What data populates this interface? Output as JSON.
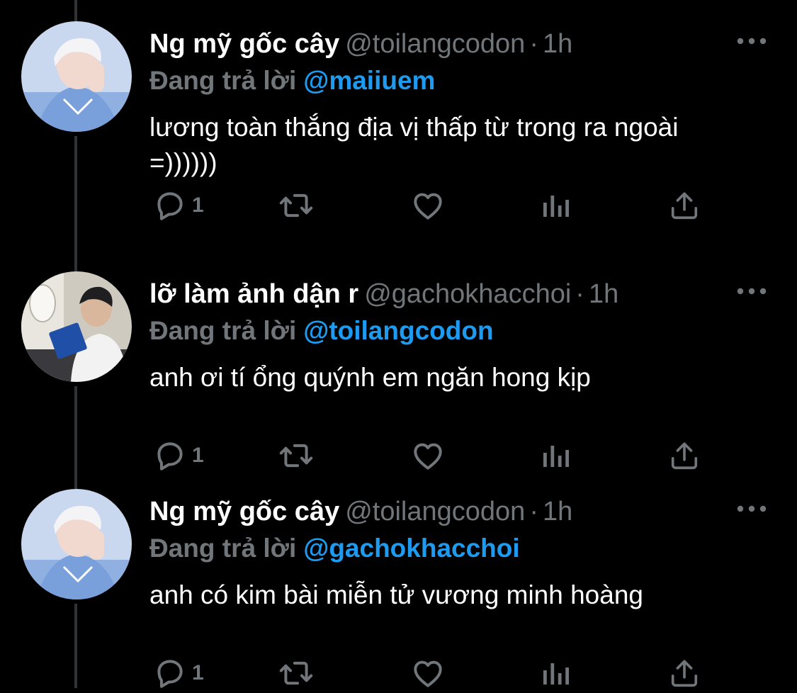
{
  "colors": {
    "background": "#000000",
    "link": "#1d9bf0",
    "muted": "#71767b",
    "text": "#ffffff"
  },
  "icons": [
    "reply-icon",
    "retweet-icon",
    "like-icon",
    "analytics-icon",
    "share-icon",
    "more-icon"
  ],
  "tweets": [
    {
      "name": "Ng mỹ gốc cây",
      "handle": "@toilangcodon",
      "separator": "·",
      "time": "1h",
      "reply_prefix": "Đang trả lời",
      "reply_to": "@maiiuem",
      "text": "lương toàn thắng địa vị thấp từ trong ra ngoài =))))))",
      "reply_count": "1"
    },
    {
      "name": "lỡ làm ảnh dận r",
      "handle": "@gachokhacchoi",
      "separator": "·",
      "time": "1h",
      "reply_prefix": "Đang trả lời",
      "reply_to": "@toilangcodon",
      "text": "anh ơi tí ổng quýnh em ngăn hong kịp",
      "reply_count": "1"
    },
    {
      "name": "Ng mỹ gốc cây",
      "handle": "@toilangcodon",
      "separator": "·",
      "time": "1h",
      "reply_prefix": "Đang trả lời",
      "reply_to": "@gachokhacchoi",
      "text": "anh có kim bài miễn tử vương minh hoàng",
      "reply_count": "1"
    }
  ]
}
